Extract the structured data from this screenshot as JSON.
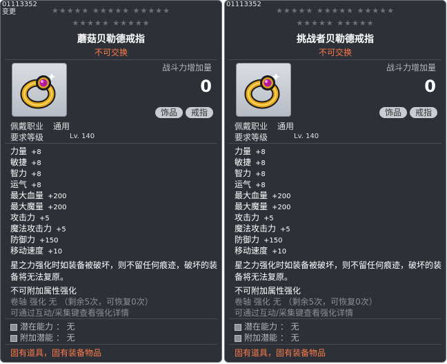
{
  "tooltips": [
    {
      "id_label": "01113352",
      "changed_label": "变更",
      "stars_row1": "★★★★★  ★★★★★  ★★★★★",
      "stars_row2": "★★★★★  ★★★★★",
      "name": "蘑菇贝勒德戒指",
      "trade_status": "不可交换",
      "icon": "ring-icon",
      "combat_power_label": "战斗力增加量",
      "combat_power_value": "0",
      "tags": [
        "饰品",
        "戒指"
      ],
      "job_label": "佩戴职业",
      "job_value": "通用",
      "level_label": "要求等级",
      "level_value": "Lv. 140",
      "stats": [
        {
          "name": "力量",
          "value": "+8"
        },
        {
          "name": "敏捷",
          "value": "+8"
        },
        {
          "name": "智力",
          "value": "+8"
        },
        {
          "name": "运气",
          "value": "+8"
        },
        {
          "name": "最大血量",
          "value": "+200"
        },
        {
          "name": "最大魔量",
          "value": "+200"
        },
        {
          "name": "攻击力",
          "value": "+5"
        },
        {
          "name": "魔法攻击力",
          "value": "+5"
        },
        {
          "name": "防御力",
          "value": "+150"
        },
        {
          "name": "移动速度",
          "value": "+10"
        }
      ],
      "description": "星之力强化时如装备被破坏，则不留任何痕迹，破坏的装备将无法复原。",
      "enhance_title": "不可附加属性强化",
      "scroll_info": "卷轴 强化 无 （剩余5次，可恢复0次）",
      "hint": "可通过互动/采集键查看强化详情",
      "potential": "潜在能力 ： 无",
      "additional_potential": "附加潜能 ： 无",
      "fixed_item": "固有道具，固有装备物品"
    },
    {
      "id_label": "01113352",
      "stars_row1": "★★★★★  ★★★★★  ★★★★★",
      "stars_row2": "★★★★★  ★★★★★",
      "name": "挑战者贝勒德戒指",
      "trade_status": "不可交换",
      "icon": "ring-icon",
      "combat_power_label": "战斗力增加量",
      "combat_power_value": "0",
      "tags": [
        "饰品",
        "戒指"
      ],
      "job_label": "佩戴职业",
      "job_value": "通用",
      "level_label": "要求等级",
      "level_value": "Lv. 140",
      "stats": [
        {
          "name": "力量",
          "value": "+8"
        },
        {
          "name": "敏捷",
          "value": "+8"
        },
        {
          "name": "智力",
          "value": "+8"
        },
        {
          "name": "运气",
          "value": "+8"
        },
        {
          "name": "最大血量",
          "value": "+200"
        },
        {
          "name": "最大魔量",
          "value": "+200"
        },
        {
          "name": "攻击力",
          "value": "+5"
        },
        {
          "name": "魔法攻击力",
          "value": "+5"
        },
        {
          "name": "防御力",
          "value": "+150"
        },
        {
          "name": "移动速度",
          "value": "+10"
        }
      ],
      "description": "星之力强化时如装备被破坏，则不留任何痕迹，破坏的装备将无法复原。",
      "enhance_title": "不可附加属性强化",
      "scroll_info": "卷轴 强化 无 （剩余5次，可恢复0次）",
      "hint": "可通过互动/采集键查看强化详情",
      "potential": "潜在能力 ： 无",
      "additional_potential": "附加潜能 ： 无",
      "fixed_item": "固有道具，固有装备物品"
    }
  ]
}
